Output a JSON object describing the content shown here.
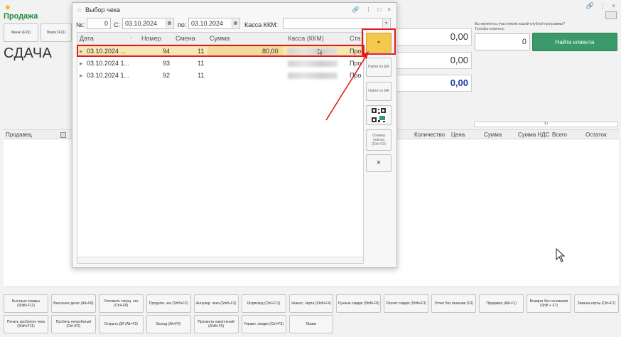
{
  "app": {
    "title": "Продажа",
    "change_label": "СДАЧА"
  },
  "toolbar": {
    "menu_label": "Меню (F10)",
    "search_label": "Поиск (F11)"
  },
  "totals": {
    "total_1": "0,00",
    "total_2": "0,00",
    "total_3": "0,00"
  },
  "client": {
    "question": "Вы являетесь участником нашей клубной программы?",
    "phone_label": "Телефон клиента:",
    "input_value": "0",
    "find_button": "Найти клиента",
    "refresh_icon": "↻"
  },
  "main_grid": {
    "columns": [
      "Продавец",
      "Количество",
      "Цена",
      "Сумма",
      "Сумма НДС",
      "Всего",
      "Остаток"
    ]
  },
  "bottom_buttons": {
    "row1": [
      "Быстрые товары (Shift+F12)",
      "Внесение денег (Alt+F8)",
      "Отложить текущ. чек (Ctrl+F8)",
      "Продолж. чек (Shift+F2)",
      "Аннулир. чека (Shift+F3)",
      "Штрихкод (Ctrl+F11)",
      "Инкасс. карта (Shift+F4)",
      "Ручные скидки (Shift+F8)",
      "Расчет скидок (Shift+F3)",
      "Отчет без гашения (F3)",
      "Продавец (Alt+F1)",
      "Возврат без основания (Shift + F7)",
      "Замена карты (Ctrl+F7)"
    ],
    "row2": [
      "Печать пробитого чека (Shift+F11)",
      "Пробить непробитый (Ctrl+F2)",
      "Открыть ДЯ (Alt+F2)",
      "Выход (Alt+F9)",
      "Просмотр накоплений (Shift+F6)",
      "Управл. скидки (Ctrl+F3)",
      "Мазки"
    ]
  },
  "dialog": {
    "title": "Выбор чека",
    "number_label": "№:",
    "number_value": "0",
    "from_label": "С:",
    "from_value": "03.10.2024",
    "to_label": "по:",
    "to_value": "03.10.2024",
    "kkm_label": "Касса ККМ:",
    "kkm_value": "",
    "columns": {
      "date": "Дата",
      "number": "Номер",
      "shift": "Смена",
      "sum": "Сумма",
      "kkm": "Касса (ККМ)",
      "status": "Ста"
    },
    "rows": [
      {
        "date": "03.10.2024 ...",
        "number": "94",
        "shift": "11",
        "sum": "80,00",
        "status": "Про"
      },
      {
        "date": "03.10.2024 1...",
        "number": "93",
        "shift": "11",
        "sum": "",
        "status": "Про"
      },
      {
        "date": "03.10.2024 1...",
        "number": "92",
        "shift": "11",
        "sum": "",
        "status": "Про"
      }
    ],
    "side_buttons": {
      "select": "●",
      "find_shk": "Найти по ШК",
      "find_mk": "Найти по МК",
      "cancel_search": "Отмена поиска (Ctrl+F3)",
      "close": "×"
    }
  },
  "colors": {
    "green_title": "#1d8a3a",
    "find_client_bg": "#3b9a6a",
    "selected_row": "#f7e7b5",
    "select_button": "#f2c94c",
    "highlight_red": "#e31b1b",
    "total_blue": "#1e3fa5"
  }
}
